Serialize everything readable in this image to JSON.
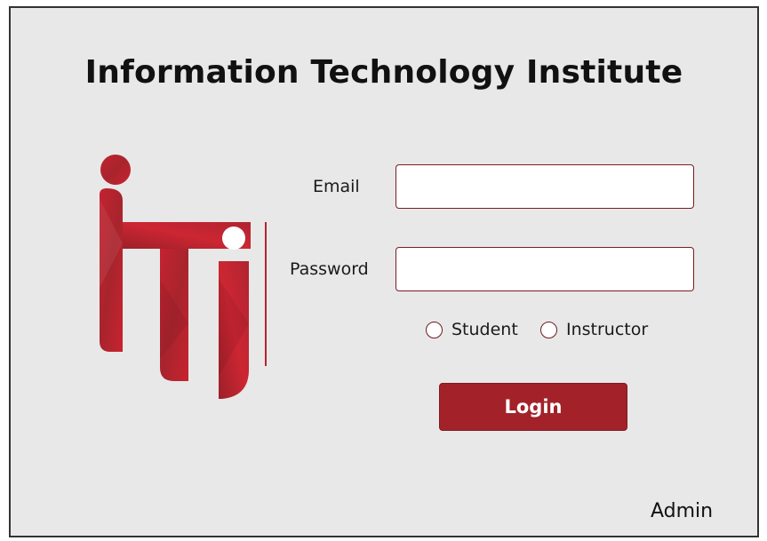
{
  "page": {
    "title": "Information Technology Institute"
  },
  "logo": {
    "icon": "iti-logo",
    "brand_color": "#a3222a"
  },
  "form": {
    "email_label": "Email",
    "email_value": "",
    "password_label": "Password",
    "password_value": "",
    "roles": [
      {
        "label": "Student",
        "selected": false
      },
      {
        "label": "Instructor",
        "selected": false
      }
    ],
    "login_label": "Login"
  },
  "footer": {
    "admin_label": "Admin"
  },
  "colors": {
    "background": "#e8e8e8",
    "accent": "#a3222a",
    "input_border": "#7a1d22"
  }
}
